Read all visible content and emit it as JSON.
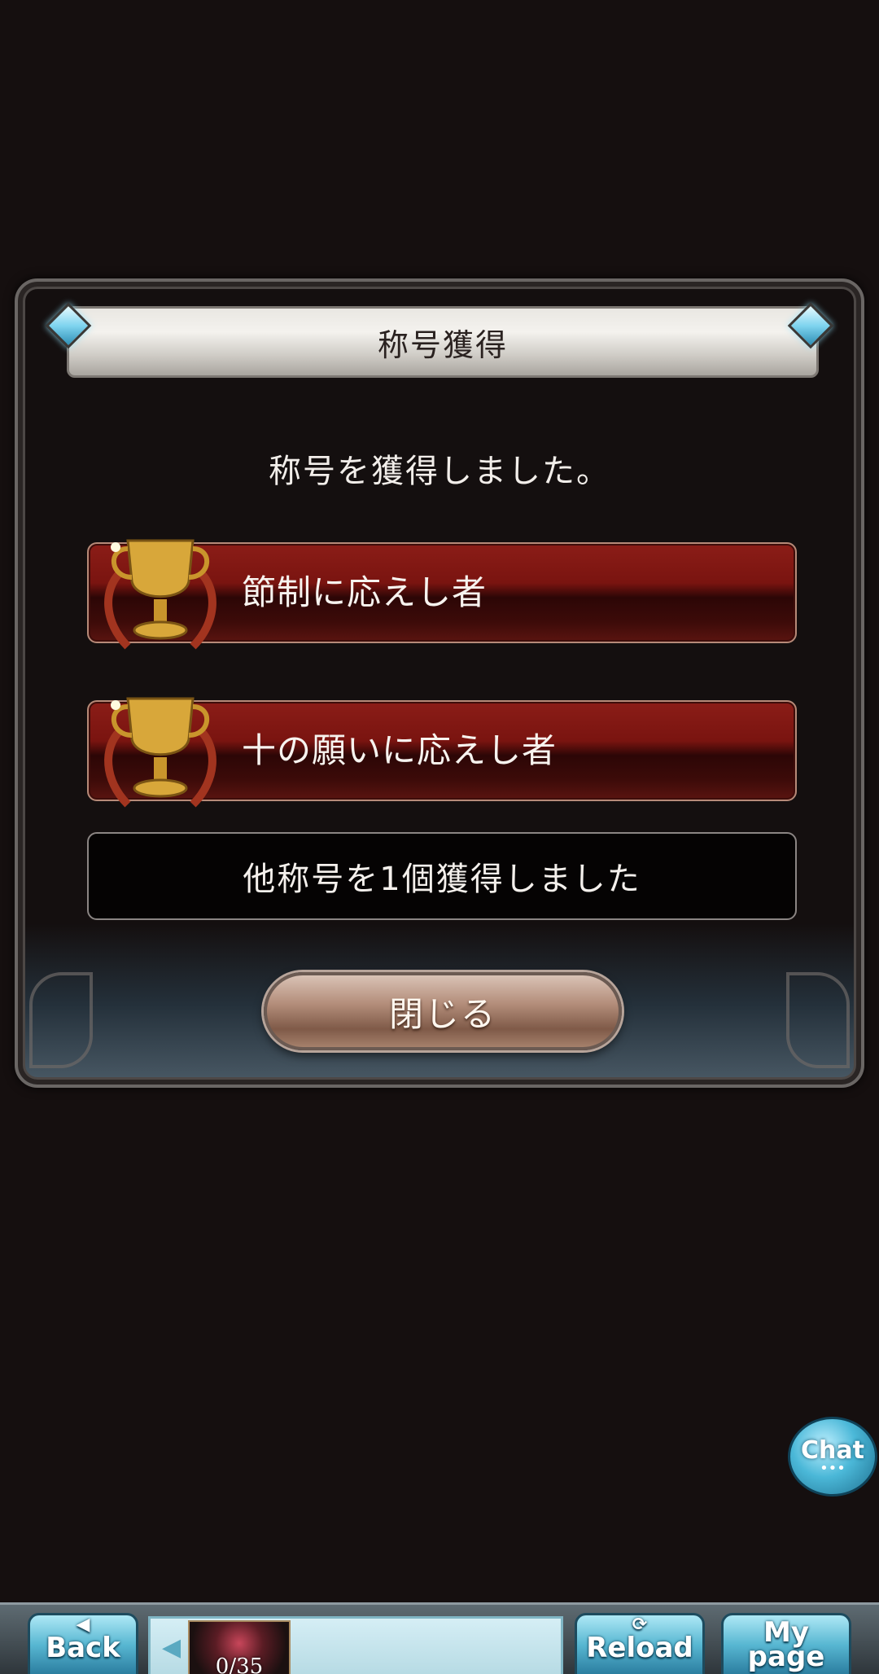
{
  "dialog": {
    "title": "称号獲得",
    "message": "称号を獲得しました。",
    "titles": [
      {
        "label": "節制に応えし者"
      },
      {
        "label": "十の願いに応えし者"
      }
    ],
    "others_text": "他称号を1個獲得しました",
    "close_label": "閉じる"
  },
  "chat": {
    "label": "Chat",
    "dots": "•••"
  },
  "bottom_nav": {
    "back_label": "Back",
    "banner_count": "0/35",
    "reload_label": "Reload",
    "mypage_label_1": "My",
    "mypage_label_2": "page"
  },
  "colors": {
    "background": "#150f0f",
    "title_bar_red": "#8b1d17",
    "accent_blue": "#58b7d2",
    "button_bronze": "#b38d7a"
  },
  "icons": [
    "gem-icon",
    "trophy-icon",
    "back-arrow-icon",
    "reload-icon",
    "left-arrow-icon"
  ]
}
